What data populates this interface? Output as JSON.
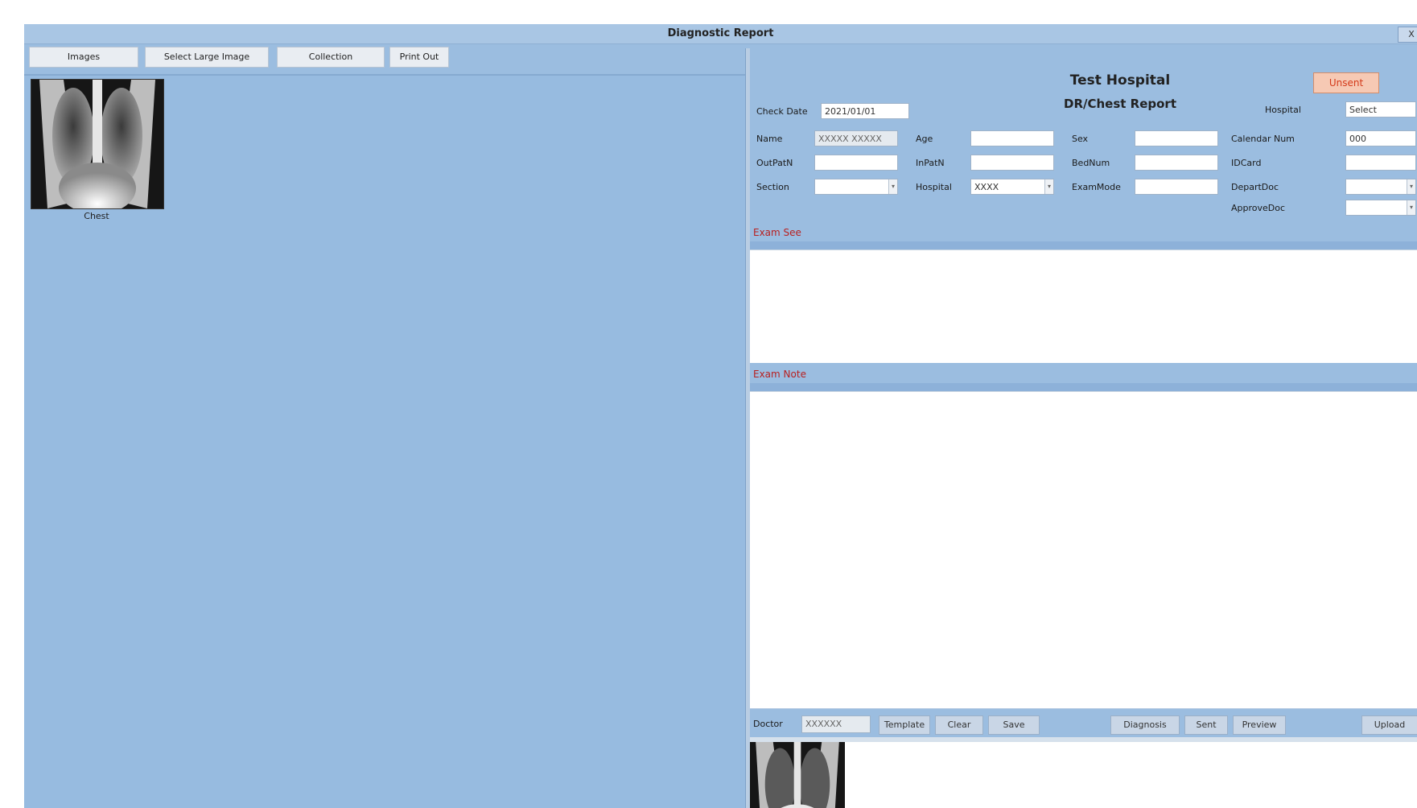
{
  "window": {
    "title": "Diagnostic Report",
    "close_label": "X"
  },
  "toolbar": {
    "images_label": "Images",
    "select_large_image_label": "Select Large Image",
    "collection_label": "Collection",
    "print_label": "Print Out"
  },
  "thumbnail": {
    "caption": "Chest"
  },
  "report": {
    "hospital_name": "Test Hospital",
    "report_type": "DR/Chest Report",
    "status_badge": "Unsent",
    "checkdate_label": "Check Date",
    "checkdate_value": "2021/01/01",
    "hospital_label": "Hospital",
    "hospital_value": "Select",
    "fields": {
      "name_label": "Name",
      "name_value": "XXXXX XXXXX",
      "age_label": "Age",
      "sex_label": "Sex",
      "calendar_label": "Calendar Num",
      "calendar_value": "000",
      "outpatient_label": "OutPatN",
      "inpatient_label": "InPatN",
      "bed_label": "BedNum",
      "idcard_label": "IDCard",
      "section_label": "Section",
      "hospital2_label": "Hospital",
      "hospital2_value": "XXXX",
      "exam_mode_label": "ExamMode",
      "depart_doc_label": "DepartDoc",
      "approve_doc_label": "ApproveDoc"
    },
    "findings_label": "Exam See",
    "diagnosis_label": "Exam Note"
  },
  "bottombar": {
    "doctor_label": "Doctor",
    "doctor_value": "XXXXXX",
    "template_label": "Template",
    "clear_label": "Clear",
    "save_label": "Save",
    "diagnosis_label": "Diagnosis",
    "sent_label": "Sent",
    "preview_label": "Preview",
    "upload_label": "Upload"
  }
}
